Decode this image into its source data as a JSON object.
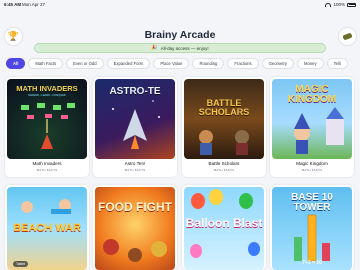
{
  "status": {
    "time": "6:45 AM",
    "date": "Mon Apr 27",
    "battery": "100%"
  },
  "header": {
    "title": "Brainy Arcade",
    "banner_icon": "🎉",
    "banner_text": "All-day access — enjoy!"
  },
  "tabs": [
    "All",
    "Math Facts",
    "Even or Odd",
    "Expanded Form",
    "Place Value",
    "Rounding",
    "Fractions",
    "Geometry",
    "Money",
    "Telli"
  ],
  "games": [
    {
      "name": "Math Invaders",
      "category": "MATH FACTS",
      "art_title": "MATH INVADERS",
      "art_sub": "DEFEND • LEARN • CONQUER"
    },
    {
      "name": "Astro Ten!",
      "category": "MATH FACTS",
      "art_title": "ASTRO-TE"
    },
    {
      "name": "Battle Scholars",
      "category": "MATH FACTS",
      "art_title": "BATTLE SCHOLARS"
    },
    {
      "name": "Magic Kingdom",
      "category": "MATH FACTS",
      "art_title": "MAGIC KINGDOM"
    },
    {
      "art_title": "BEACH WAR",
      "badge": "Tablet"
    },
    {
      "art_title": "FOOD FIGHT"
    },
    {
      "art_title": "Balloon Blast"
    },
    {
      "art_title": "BASE 10 TOWER",
      "art_sub": "7+3 = 10"
    }
  ],
  "colors": {
    "accent": "#4f46e5",
    "banner_bg": "#d9ecd6"
  }
}
